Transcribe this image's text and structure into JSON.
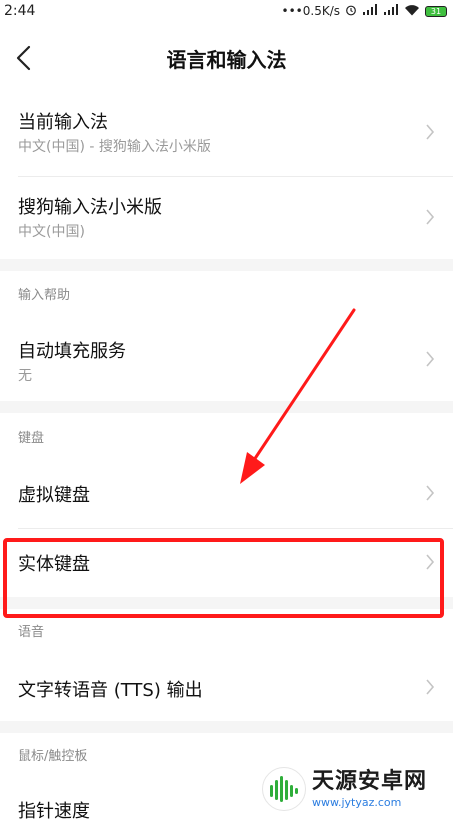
{
  "status_bar": {
    "time": "2:44",
    "net_speed": "•••0.5K/s",
    "battery_level": "31"
  },
  "header": {
    "title": "语言和输入法"
  },
  "rows": {
    "current_ime": {
      "title": "当前输入法",
      "subtitle": "中文(中国) - 搜狗输入法小米版"
    },
    "sogou": {
      "title": "搜狗输入法小米版",
      "subtitle": "中文(中国)"
    },
    "autofill": {
      "title": "自动填充服务",
      "subtitle": "无"
    },
    "virtual_keyboard": {
      "title": "虚拟键盘"
    },
    "physical_keyboard": {
      "title": "实体键盘"
    },
    "tts": {
      "title": "文字转语音 (TTS) 输出"
    },
    "pointer_speed": {
      "title": "指针速度"
    }
  },
  "sections": {
    "input_help": "输入帮助",
    "keyboard": "键盘",
    "voice": "语音",
    "mouse": "鼠标/触控板"
  },
  "annotation": {
    "color": "#ff1a1a"
  },
  "watermark": {
    "name": "天源安卓网",
    "url": "www.jytyaz.com"
  }
}
